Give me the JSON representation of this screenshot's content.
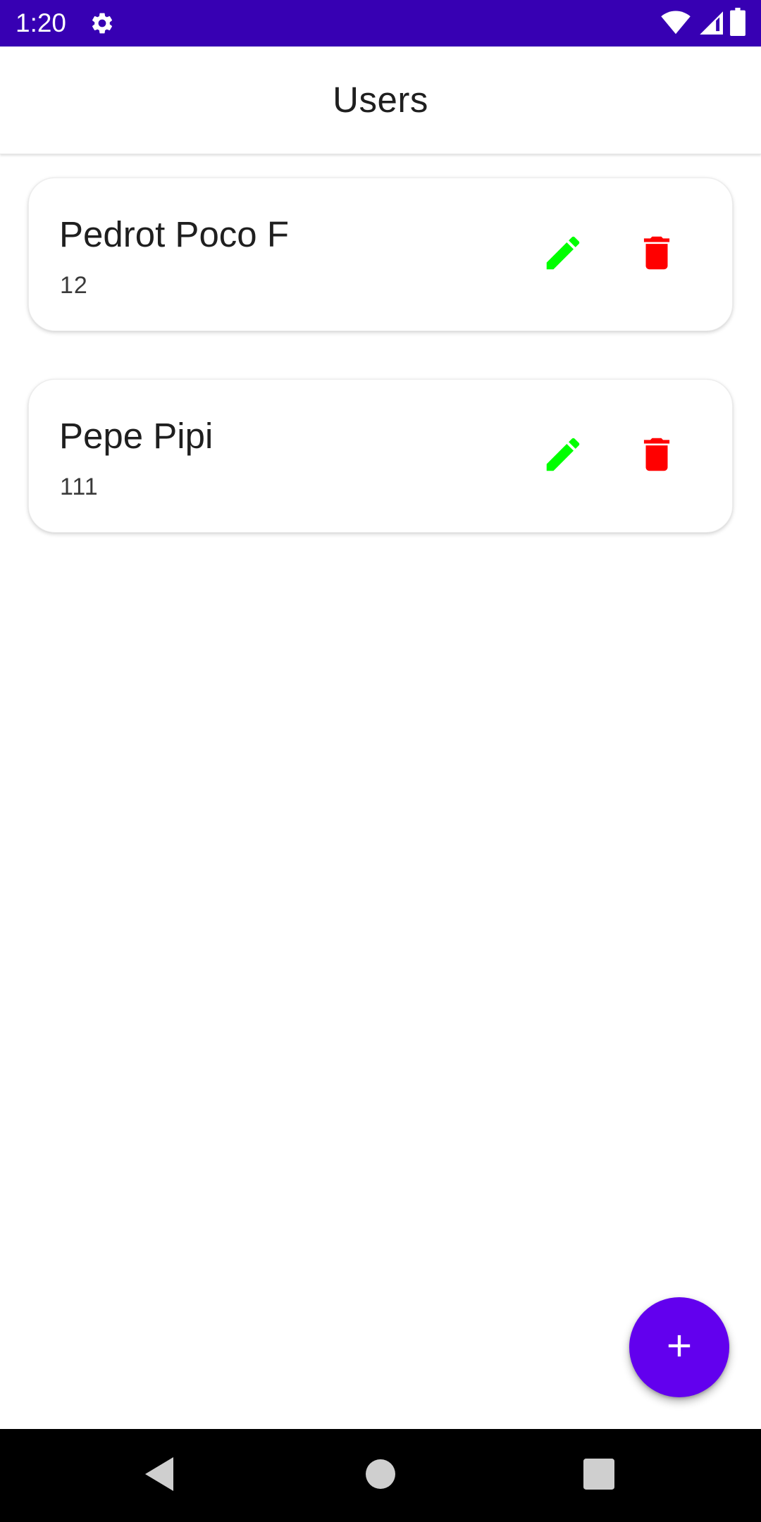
{
  "status_bar": {
    "time": "1:20",
    "left_icon": "gear-icon",
    "right_icons": [
      "wifi-icon",
      "cell-signal-icon",
      "battery-icon"
    ],
    "background": "#3700b3"
  },
  "app_bar": {
    "title": "Users"
  },
  "users": [
    {
      "name": "Pedrot Poco F",
      "detail": "12"
    },
    {
      "name": "Pepe Pipi",
      "detail": "111"
    }
  ],
  "actions": {
    "edit_icon": "pencil-icon",
    "edit_color": "#00ff00",
    "delete_icon": "trash-icon",
    "delete_color": "#ff0000"
  },
  "fab": {
    "icon": "plus-icon",
    "color": "#6200ee"
  },
  "nav_bar": {
    "buttons": [
      "back-icon",
      "home-icon",
      "recents-icon"
    ]
  }
}
